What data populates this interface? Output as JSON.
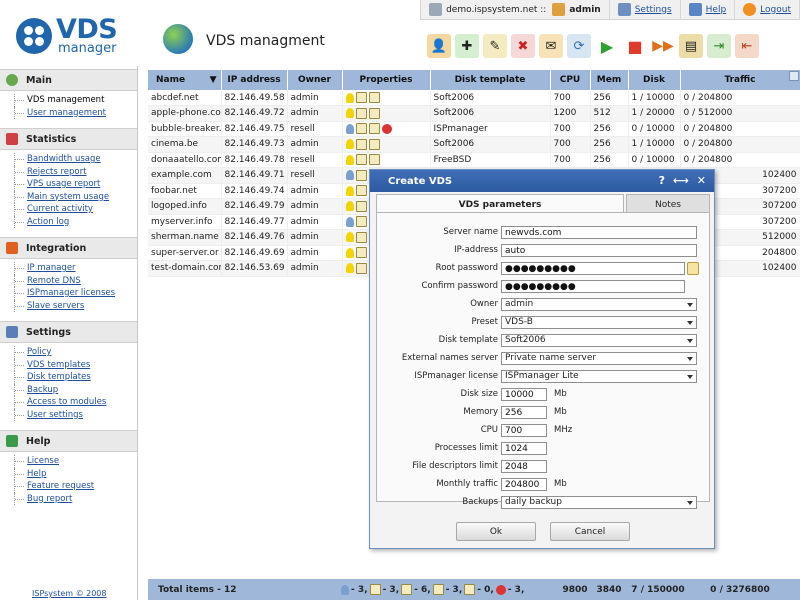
{
  "topbar": {
    "server": "demo.ispsystem.net ::",
    "user": "admin",
    "settings": "Settings",
    "help": "Help",
    "logout": "Logout"
  },
  "logo": {
    "brand": "VDS",
    "sub": "manager"
  },
  "page_title": "VDS managment",
  "toolbar_icons": [
    "add-user-icon",
    "new-icon",
    "edit-icon",
    "delete-icon",
    "mail-icon",
    "refresh-icon",
    "start-icon",
    "stop-icon",
    "restart-icon",
    "disk-icon",
    "import-icon",
    "export-icon"
  ],
  "sidebar": {
    "groups": [
      {
        "title": "Main",
        "items": [
          "VDS management",
          "User management"
        ]
      },
      {
        "title": "Statistics",
        "items": [
          "Bandwidth usage",
          "Rejects report",
          "VPS usage report",
          "Main system usage",
          "Current activity",
          "Action log"
        ]
      },
      {
        "title": "Integration",
        "items": [
          "IP manager",
          "Remote DNS",
          "ISPmanager licenses",
          "Slave servers"
        ]
      },
      {
        "title": "Settings",
        "items": [
          "Policy",
          "VDS templates",
          "Disk templates",
          "Backup",
          "Access to modules",
          "User settings"
        ]
      },
      {
        "title": "Help",
        "items": [
          "License",
          "Help",
          "Feature request",
          "Bug report"
        ]
      }
    ],
    "copyright": "ISPsystem © 2008"
  },
  "table": {
    "columns": [
      "Name",
      "IP address",
      "Owner",
      "Properties",
      "Disk template",
      "CPU",
      "Mem",
      "Disk",
      "Traffic"
    ],
    "rows": [
      {
        "name": "abcdef.net",
        "ip": "82.146.49.58",
        "owner": "admin",
        "disk_template": "Soft2006",
        "cpu": "700",
        "mem": "256",
        "disk": "1 / 10000",
        "traffic": "0 / 204800"
      },
      {
        "name": "apple-phone.com",
        "ip": "82.146.49.72",
        "owner": "admin",
        "disk_template": "Soft2006",
        "cpu": "1200",
        "mem": "512",
        "disk": "1 / 20000",
        "traffic": "0 / 512000"
      },
      {
        "name": "bubble-breaker.",
        "ip": "82.146.49.75",
        "owner": "resell",
        "disk_template": "ISPmanager",
        "cpu": "700",
        "mem": "256",
        "disk": "0 / 10000",
        "traffic": "0 / 204800"
      },
      {
        "name": "cinema.be",
        "ip": "82.146.49.73",
        "owner": "admin",
        "disk_template": "Soft2006",
        "cpu": "700",
        "mem": "256",
        "disk": "1 / 10000",
        "traffic": "0 / 204800"
      },
      {
        "name": "donaaatello.com",
        "ip": "82.146.49.78",
        "owner": "resell",
        "disk_template": "FreeBSD",
        "cpu": "700",
        "mem": "256",
        "disk": "0 / 10000",
        "traffic": "0 / 204800"
      },
      {
        "name": "example.com",
        "ip": "82.146.49.71",
        "owner": "resell",
        "disk_template": "",
        "cpu": "",
        "mem": "",
        "disk": "",
        "traffic": "102400"
      },
      {
        "name": "foobar.net",
        "ip": "82.146.49.74",
        "owner": "admin",
        "disk_template": "",
        "cpu": "",
        "mem": "",
        "disk": "",
        "traffic": "307200"
      },
      {
        "name": "logoped.info",
        "ip": "82.146.49.79",
        "owner": "admin",
        "disk_template": "",
        "cpu": "",
        "mem": "",
        "disk": "",
        "traffic": "307200"
      },
      {
        "name": "myserver.info",
        "ip": "82.146.49.77",
        "owner": "admin",
        "disk_template": "",
        "cpu": "",
        "mem": "",
        "disk": "",
        "traffic": "307200"
      },
      {
        "name": "sherman.name",
        "ip": "82.146.49.76",
        "owner": "admin",
        "disk_template": "",
        "cpu": "",
        "mem": "",
        "disk": "",
        "traffic": "512000"
      },
      {
        "name": "super-server.or",
        "ip": "82.146.49.69",
        "owner": "admin",
        "disk_template": "",
        "cpu": "",
        "mem": "",
        "disk": "",
        "traffic": "204800"
      },
      {
        "name": "test-domain.com",
        "ip": "82.146.53.69",
        "owner": "admin",
        "disk_template": "",
        "cpu": "",
        "mem": "",
        "disk": "",
        "traffic": "102400"
      }
    ],
    "footer": {
      "total": "Total items - 12",
      "props": [
        "- 3,",
        "- 3,",
        "- 6,",
        "- 3,",
        "- 0,",
        "- 3,"
      ],
      "cpu": "9800",
      "mem": "3840",
      "disk": "7 / 150000",
      "traffic": "0 / 3276800"
    }
  },
  "dialog": {
    "title": "Create VDS",
    "controls": [
      "?",
      "⟷",
      "✕"
    ],
    "tab_active": "VDS parameters",
    "tab_inactive": "Notes",
    "fields": {
      "server_name": {
        "label": "Server name",
        "value": "newvds.com"
      },
      "ip": {
        "label": "IP-address",
        "value": "auto"
      },
      "root_password": {
        "label": "Root password",
        "value": "●●●●●●●●●"
      },
      "confirm_password": {
        "label": "Confirm password",
        "value": "●●●●●●●●●"
      },
      "owner": {
        "label": "Owner",
        "value": "admin"
      },
      "preset": {
        "label": "Preset",
        "value": "VDS-B"
      },
      "disk_template": {
        "label": "Disk template",
        "value": "Soft2006"
      },
      "ext_ns": {
        "label": "External names server",
        "value": "Private name server"
      },
      "ispmanager": {
        "label": "ISPmanager license",
        "value": "ISPmanager Lite"
      },
      "disk_size": {
        "label": "Disk size",
        "value": "10000",
        "unit": "Mb"
      },
      "memory": {
        "label": "Memory",
        "value": "256",
        "unit": "Mb"
      },
      "cpu": {
        "label": "CPU",
        "value": "700",
        "unit": "MHz"
      },
      "proc_limit": {
        "label": "Processes limit",
        "value": "1024"
      },
      "fd_limit": {
        "label": "File descriptors limit",
        "value": "2048"
      },
      "traffic": {
        "label": "Monthly traffic",
        "value": "204800",
        "unit": "Mb"
      },
      "backups": {
        "label": "Backups",
        "value": "daily backup"
      }
    },
    "ok": "Ok",
    "cancel": "Cancel"
  }
}
